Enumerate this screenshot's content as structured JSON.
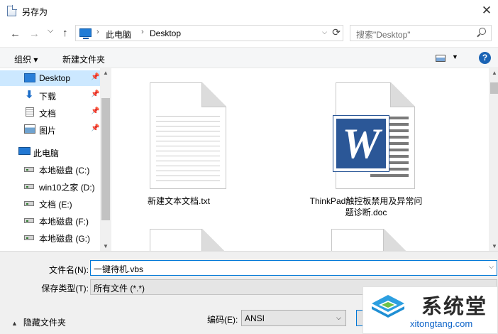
{
  "window": {
    "title": "另存为",
    "close_glyph": "✕"
  },
  "nav": {
    "back": "←",
    "forward": "→",
    "dropdown": "⌵",
    "up": "↑",
    "address": {
      "crumb1": "此电脑",
      "crumb2": "Desktop",
      "sep": "›"
    },
    "search_placeholder": "搜索\"Desktop\""
  },
  "toolbar": {
    "organize": "组织 ▾",
    "new_folder": "新建文件夹",
    "help": "?"
  },
  "sidebar": {
    "items": [
      {
        "label": "Desktop",
        "icon": "desktop-icon",
        "pinned": true,
        "selected": true
      },
      {
        "label": "下载",
        "icon": "download-icon",
        "pinned": true
      },
      {
        "label": "文档",
        "icon": "document-icon",
        "pinned": true
      },
      {
        "label": "图片",
        "icon": "pictures-icon",
        "pinned": true
      },
      {
        "label": "此电脑",
        "icon": "computer-icon"
      },
      {
        "label": "本地磁盘 (C:)",
        "icon": "windows-drive-icon"
      },
      {
        "label": "win10之家 (D:)",
        "icon": "drive-icon"
      },
      {
        "label": "文档 (E:)",
        "icon": "drive-icon"
      },
      {
        "label": "本地磁盘 (F:)",
        "icon": "drive-icon"
      },
      {
        "label": "本地磁盘 (G:)",
        "icon": "drive-icon"
      }
    ]
  },
  "files": [
    {
      "name": "新建文本文档.txt",
      "type": "text"
    },
    {
      "name_line1": "ThinkPad触控板禁用及异常问",
      "name_line2": "题诊断.doc",
      "type": "word"
    }
  ],
  "footer": {
    "filename_label": "文件名(N):",
    "filename_value": "一键待机.vbs",
    "filetype_label": "保存类型(T):",
    "filetype_value": "所有文件  (*.*)",
    "hide_folders": "隐藏文件夹",
    "encoding_label": "编码(E):",
    "encoding_value": "ANSI"
  },
  "watermark": {
    "brand": "系统堂",
    "domain": "xitongtang.com"
  }
}
